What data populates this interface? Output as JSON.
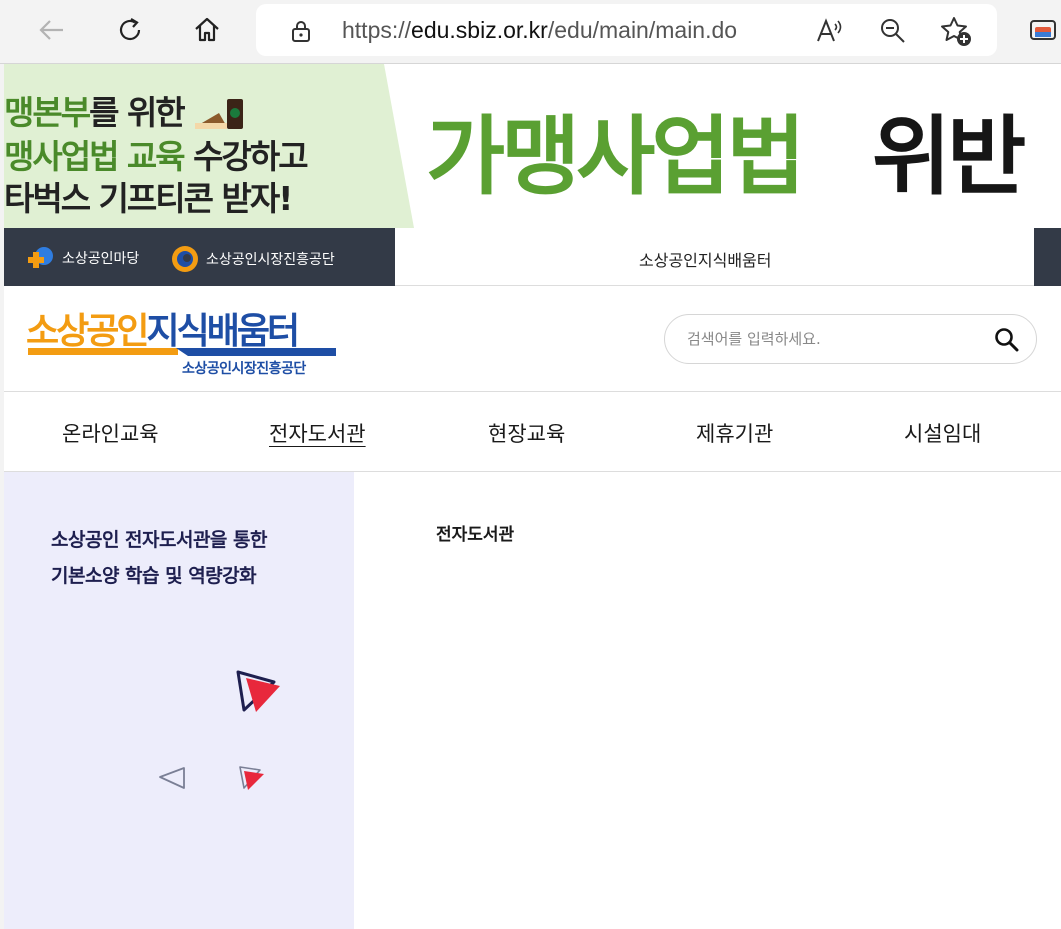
{
  "browser": {
    "url_prefix": "https://",
    "url_domain": "edu.sbiz.or.kr",
    "url_path": "/edu/main/main.do",
    "icons": [
      "back-icon",
      "refresh-icon",
      "home-icon",
      "lock-icon",
      "read-aloud-icon",
      "zoom-out-icon",
      "favorite-add-icon",
      "collections-icon"
    ]
  },
  "banner": {
    "line1_green": "맹본부",
    "line1_dark": "를 위한",
    "line2_green": "맹사업법 교육",
    "line2_dark": " 수강하고",
    "line3": "타벅스 기프티콘 받자!",
    "big_green": "가맹사업법",
    "big_dark": "위반"
  },
  "utilbar": {
    "link1": "소상공인마당",
    "link2": "소상공인시장진흥공단",
    "title": "소상공인지식배움터"
  },
  "header": {
    "logo_orange": "소상공인",
    "logo_blue": "지식배움터",
    "logo_sub": "소상공인시장진흥공단",
    "search_placeholder": "검색어를 입력하세요."
  },
  "nav": {
    "items": [
      "온라인교육",
      "전자도서관",
      "현장교육",
      "제휴기관",
      "시설임대"
    ],
    "active": "전자도서관"
  },
  "sidebar": {
    "line1": "소상공인 전자도서관을 통한",
    "line2": "기본소양 학습 및 역량강화"
  },
  "content": {
    "title": "전자도서관"
  },
  "colors": {
    "accent_orange": "#f39c12",
    "accent_blue": "#1e4ea5",
    "util_dark": "#333a47",
    "sidebar_bg": "#ededfb",
    "deco_red": "#e8283c"
  }
}
